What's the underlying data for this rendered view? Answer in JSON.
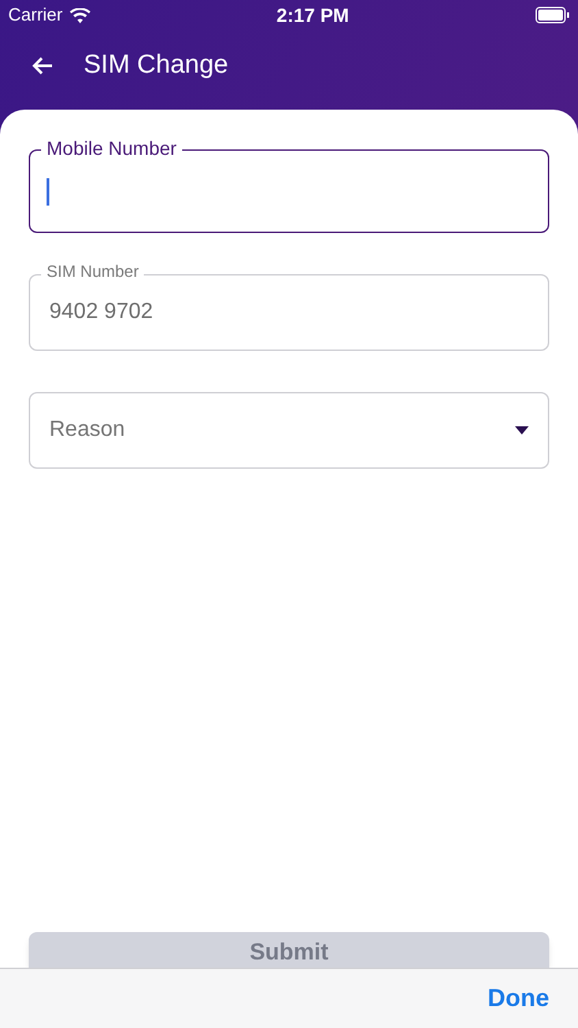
{
  "status_bar": {
    "carrier": "Carrier",
    "time": "2:17 PM"
  },
  "header": {
    "title": "SIM Change"
  },
  "fields": [
    {
      "kind": "text",
      "label": "Mobile Number",
      "focused": true
    },
    {
      "kind": "text",
      "label": "SIM Number",
      "value": "9402 9702",
      "focused": false
    },
    {
      "kind": "select",
      "placeholder": "Reason",
      "focused": false
    }
  ],
  "submit": {
    "label": "Submit",
    "disabled": true
  },
  "keyboard_toolbar": {
    "done": "Done"
  }
}
